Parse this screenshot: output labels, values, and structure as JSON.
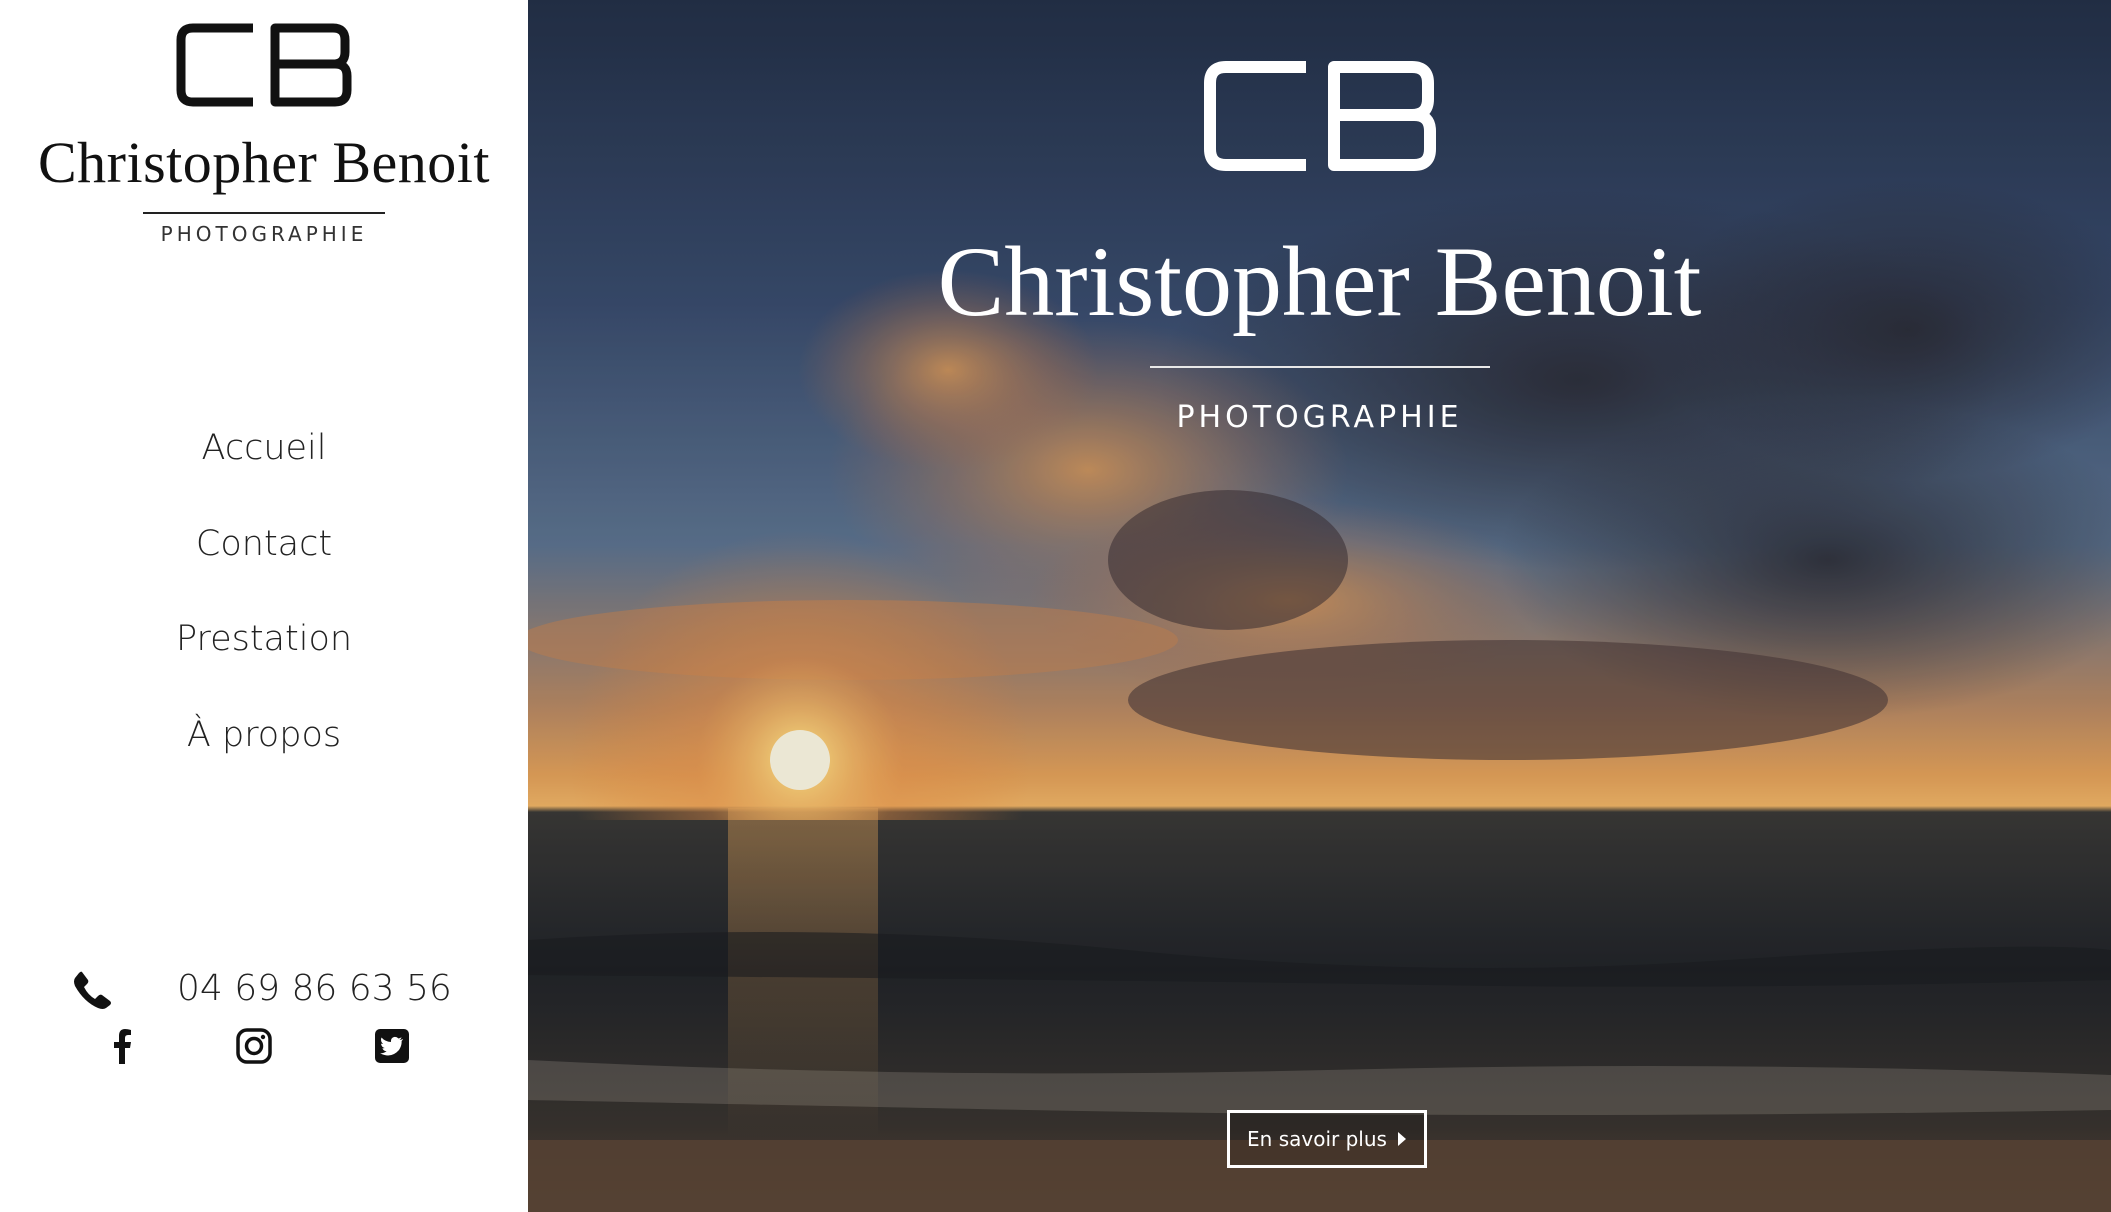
{
  "sidebar": {
    "logo_monogram": "CB",
    "brand_name": "Christopher Benoit",
    "brand_subtitle": "PHOTOGRAPHIE",
    "nav": [
      {
        "label": "Accueil"
      },
      {
        "label": "Contact"
      },
      {
        "label": "Prestation"
      },
      {
        "label": "À propos"
      }
    ],
    "phone": "04 69 86 63 56",
    "icons": [
      "phone-icon",
      "facebook-icon",
      "instagram-icon",
      "twitter-icon"
    ]
  },
  "hero": {
    "logo_monogram": "CB",
    "brand_name": "Christopher Benoit",
    "brand_subtitle": "PHOTOGRAPHIE",
    "cta_label": "En savoir plus"
  },
  "colors": {
    "sidebar_bg": "#ffffff",
    "text_dark": "#111111",
    "hero_text": "#ffffff"
  }
}
